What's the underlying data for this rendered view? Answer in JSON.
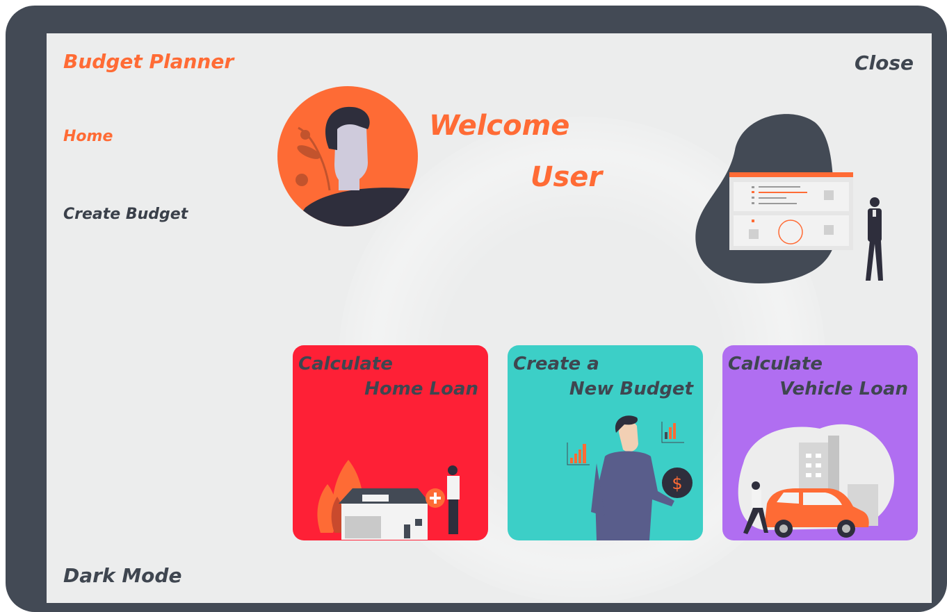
{
  "app": {
    "title": "Budget Planner",
    "close_label": "Close"
  },
  "sidebar": {
    "items": [
      {
        "label": "Home",
        "active": true
      },
      {
        "label": "Create Budget",
        "active": false
      }
    ],
    "dark_mode_label": "Dark Mode"
  },
  "greeting": {
    "line1": "Welcome",
    "line2": "User"
  },
  "cards": [
    {
      "line1": "Calculate",
      "line2": "Home Loan",
      "color": "#fe2036",
      "icon": "house-illustration"
    },
    {
      "line1": "Create a",
      "line2": "New Budget",
      "color": "#3ccfc7",
      "icon": "person-finance-illustration"
    },
    {
      "line1": "Calculate",
      "line2": "Vehicle Loan",
      "color": "#b06ef1",
      "icon": "car-illustration"
    }
  ],
  "colors": {
    "accent": "#ff6b35",
    "frame": "#434a55",
    "panel": "#eceded",
    "text_dark": "#3f4650"
  }
}
